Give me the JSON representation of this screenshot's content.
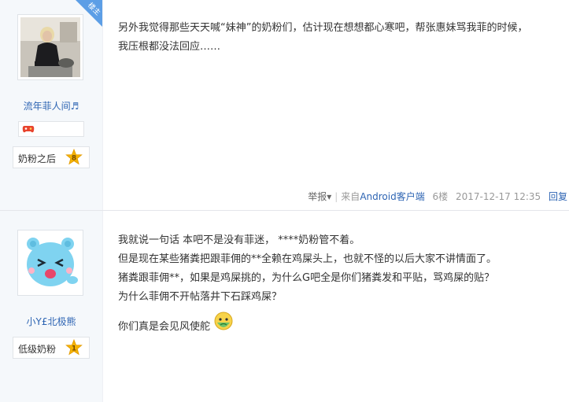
{
  "posts": [
    {
      "author": {
        "name": "流年菲人间♬",
        "badge_label": "奶粉之后",
        "badge_level": "8",
        "corner_tag": "楼主"
      },
      "content": [
        "另外我觉得那些天天喊“妹神”的奶粉们，估计现在想想都心寒吧，帮张惠妹骂我菲的时候，",
        "我压根都没法回应……"
      ],
      "tail": {
        "report": "举报",
        "source_prefix": "来自",
        "source_link": "Android客户端",
        "floor": "6楼",
        "time": "2017-12-17 12:35",
        "reply": "回复"
      }
    },
    {
      "author": {
        "name": "小Y£北极熊",
        "badge_label": "低级奶粉",
        "badge_level": "1"
      },
      "content": [
        "我就说一句话 本吧不是没有菲迷， ****奶粉管不着。",
        "但是现在某些猪粪把跟菲佣的**全赖在鸡屎头上，也就不怪的以后大家不讲情面了。",
        "猪粪跟菲佣**，如果是鸡屎挑的，为什么G吧全是你们猪粪发和平贴，骂鸡屎的贴？",
        "为什么菲佣不开帖落井下石踩鸡屎？",
        "你们真是会见风使舵"
      ]
    }
  ],
  "colors": {
    "link": "#2d64b3",
    "sidebar": "#f5f8fb",
    "badge_star": "#f5b400"
  }
}
